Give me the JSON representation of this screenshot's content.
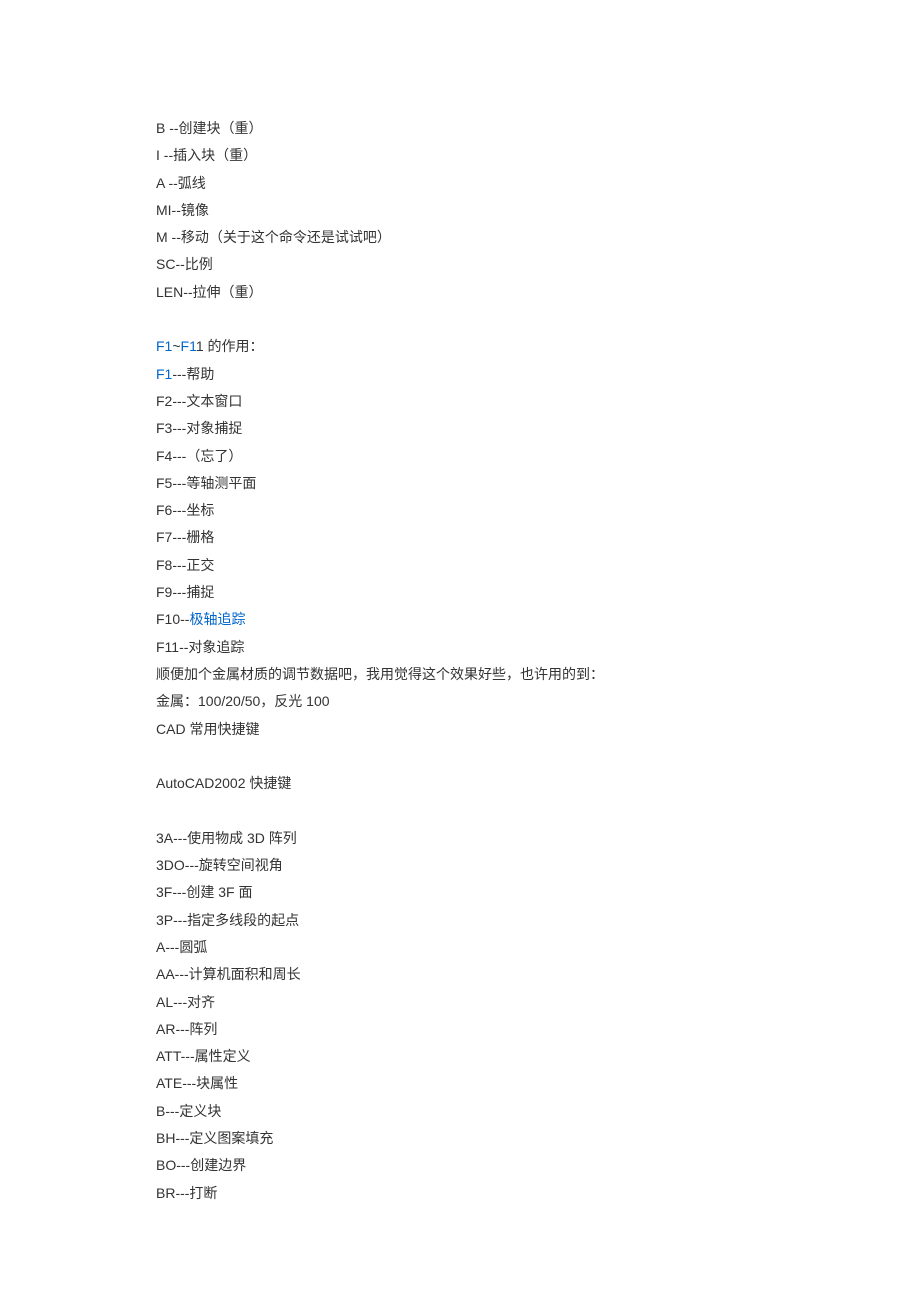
{
  "section1": [
    "B --创建块（重）",
    "I --插入块（重）",
    "A --弧线",
    "MI--镜像",
    "M --移动（关于这个命令还是试试吧）",
    "SC--比例",
    "LEN--拉伸（重）"
  ],
  "fkeys_header": {
    "link1": "F1",
    "sep": "~",
    "link2": "F1",
    "rest": "1 的作用："
  },
  "fkeys": {
    "f1_link": "F1",
    "f1_rest": "---帮助",
    "f2": "F2---文本窗口",
    "f3": "F3---对象捕捉",
    "f4": "F4---（忘了）",
    "f5": "F5---等轴测平面",
    "f6": "F6---坐标",
    "f7": "F7---栅格",
    "f8": "F8---正交",
    "f9": "F9---捕捉",
    "f10_prefix": "F10--",
    "f10_link": "极轴追踪",
    "f11": "F11--对象追踪"
  },
  "notes": [
    "顺便加个金属材质的调节数据吧，我用觉得这个效果好些，也许用的到：",
    "金属：100/20/50，反光 100",
    "CAD 常用快捷键"
  ],
  "autocad_title": "AutoCAD2002 快捷键",
  "section3": [
    "3A---使用物成 3D 阵列",
    "3DO---旋转空间视角",
    "3F---创建 3F 面",
    "3P---指定多线段的起点",
    "A---圆弧",
    "AA---计算机面积和周长",
    "AL---对齐",
    "AR---阵列",
    "ATT---属性定义",
    "ATE---块属性",
    "B---定义块",
    "BH---定义图案填充",
    "BO---创建边界",
    "BR---打断"
  ]
}
